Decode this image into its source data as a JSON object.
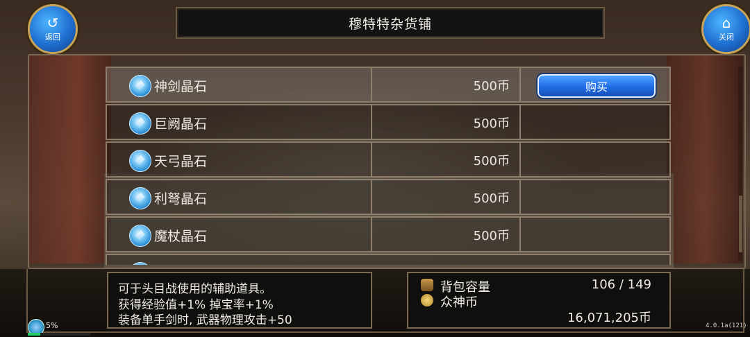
{
  "header": {
    "title": "穆特特杂货铺",
    "back_label": "返回",
    "close_label": "关闭"
  },
  "shop": {
    "items": [
      {
        "name": "神剑晶石",
        "price": "500币",
        "selected": true
      },
      {
        "name": "巨阙晶石",
        "price": "500币",
        "selected": false
      },
      {
        "name": "天弓晶石",
        "price": "500币",
        "selected": false
      },
      {
        "name": "利弩晶石",
        "price": "500币",
        "selected": false
      },
      {
        "name": "魔杖晶石",
        "price": "500币",
        "selected": false
      }
    ],
    "buy_label": "购买"
  },
  "description": {
    "lines": [
      "可于头目战使用的辅助道具。",
      "获得经验值+1% 掉宝率+1%",
      "装备单手剑时, 武器物理攻击+50"
    ]
  },
  "inventory": {
    "bag_label": "背包容量",
    "bag_value": "106 / 149",
    "coin_label": "众神币",
    "coin_value": "16,071,205币"
  },
  "status": {
    "exp_percent": "5%",
    "exp_fraction": 0.05,
    "version": "4.0.1a(121)"
  },
  "colors": {
    "buy_button": "#1f6ce6",
    "gem": "#7cc9f5",
    "frame": "#8d7f6c"
  }
}
